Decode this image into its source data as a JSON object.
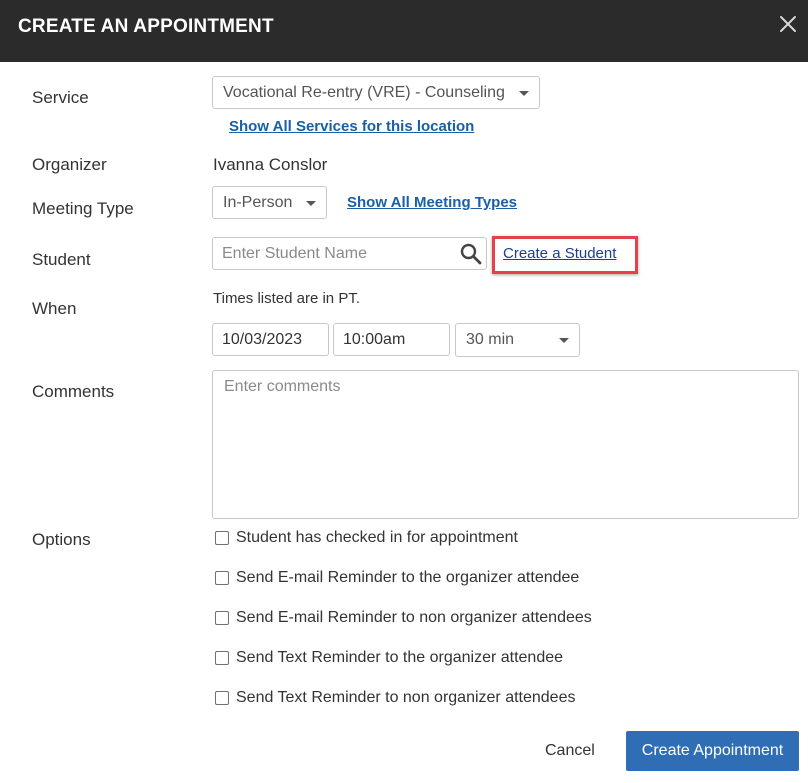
{
  "dialog": {
    "title": "CREATE AN APPOINTMENT"
  },
  "form": {
    "service": {
      "label": "Service",
      "selected": "Vocational Re-entry (VRE) - Counseling",
      "show_all_link": "Show All Services for this location"
    },
    "organizer": {
      "label": "Organizer",
      "value": "Ivanna Conslor"
    },
    "meeting_type": {
      "label": "Meeting Type",
      "selected": "In-Person",
      "show_all_link": "Show All Meeting Types"
    },
    "student": {
      "label": "Student",
      "placeholder": "Enter Student Name",
      "create_link": "Create a Student"
    },
    "when": {
      "label": "When",
      "timezone_note": "Times listed are in PT.",
      "date": "10/03/2023",
      "time": "10:00am",
      "duration": "30 min"
    },
    "comments": {
      "label": "Comments",
      "placeholder": "Enter comments"
    },
    "options": {
      "label": "Options",
      "items": [
        {
          "label": "Student has checked in for appointment",
          "checked": false
        },
        {
          "label": "Send E-mail Reminder to the organizer attendee",
          "checked": false
        },
        {
          "label": "Send E-mail Reminder to non organizer attendees",
          "checked": false
        },
        {
          "label": "Send Text Reminder to the organizer attendee",
          "checked": false
        },
        {
          "label": "Send Text Reminder to non organizer attendees",
          "checked": false
        }
      ]
    }
  },
  "footer": {
    "cancel_label": "Cancel",
    "submit_label": "Create Appointment"
  },
  "colors": {
    "header_bg": "#2b2b2b",
    "primary_button": "#2f6db5",
    "link": "#1a5fa6",
    "highlight": "#e4414a"
  }
}
